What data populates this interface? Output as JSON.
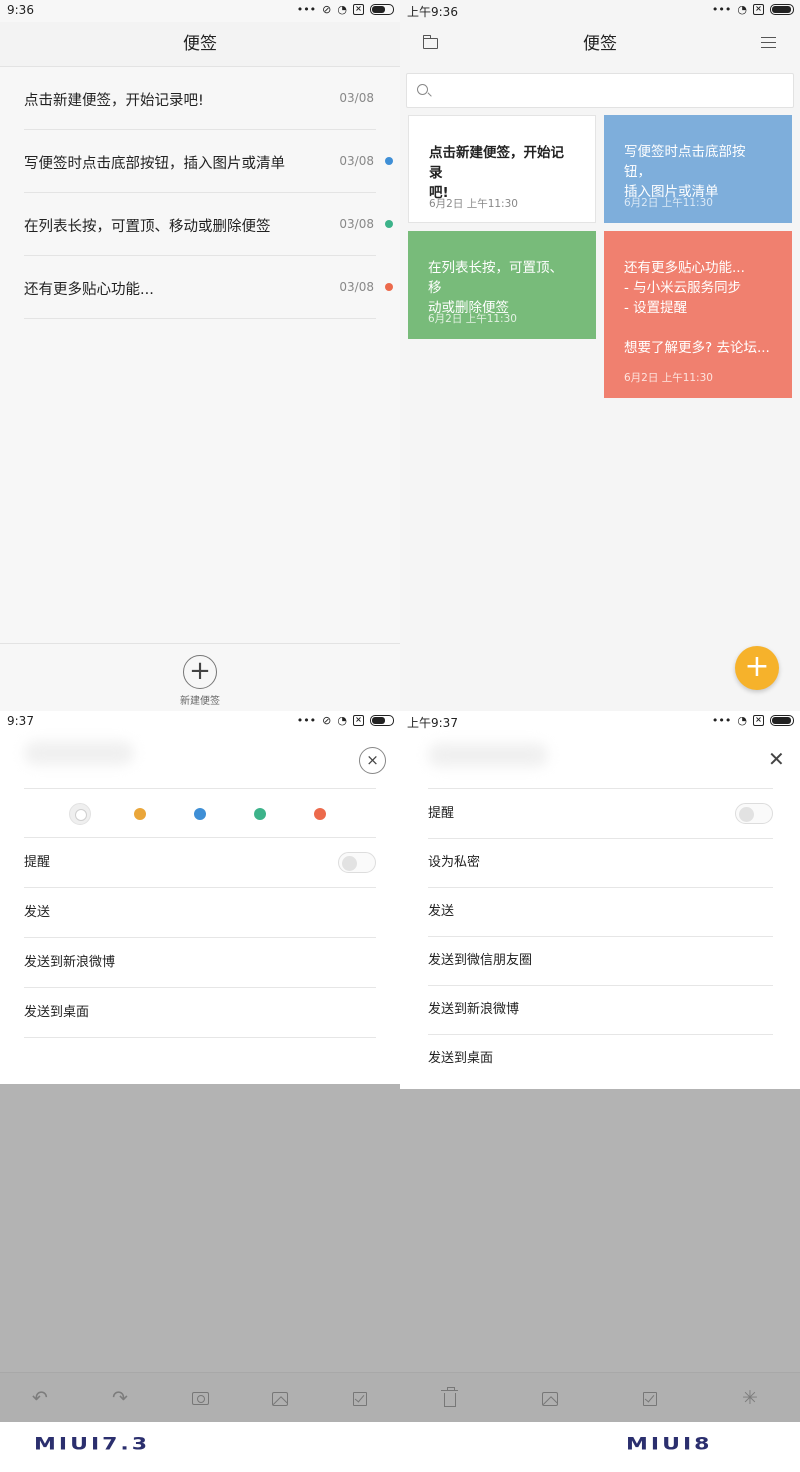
{
  "q1": {
    "status": {
      "time": "9:36"
    },
    "title": "便签",
    "notes": [
      {
        "text": "点击新建便签，开始记录吧!",
        "date": "03/08",
        "dot": ""
      },
      {
        "text": "写便签时点击底部按钮，插入图片或清单",
        "date": "03/08",
        "dot": "#3f8fd6"
      },
      {
        "text": "在列表长按，可置顶、移动或删除便签",
        "date": "03/08",
        "dot": "#3db38a"
      },
      {
        "text": "还有更多贴心功能...",
        "date": "03/08",
        "dot": "#ec6a4c"
      }
    ],
    "new_note_label": "新建便签"
  },
  "q2": {
    "status": {
      "time": "上午9:36"
    },
    "title": "便签",
    "cards": [
      {
        "text": "点击新建便签，开始记录\n吧!",
        "date": "6月2日 上午11:30",
        "bg": "#ffffff",
        "fg": "#222222"
      },
      {
        "text": "写便签时点击底部按钮，\n插入图片或清单",
        "date": "6月2日 上午11:30",
        "bg": "#7eaedb",
        "fg": "#ffffff"
      },
      {
        "text": "在列表长按，可置顶、移\n动或删除便签",
        "date": "6月2日 上午11:30",
        "bg": "#78bb7a",
        "fg": "#ffffff"
      },
      {
        "text": "还有更多贴心功能...\n  - 与小米云服务同步\n  - 设置提醒\n\n想要了解更多? 去论坛...",
        "date": "6月2日 上午11:30",
        "bg": "#f0806f",
        "fg": "#ffffff"
      }
    ],
    "fab_symbol": "+"
  },
  "q3": {
    "status": {
      "time": "9:37"
    },
    "colors": [
      "#ffffff",
      "#eaa63a",
      "#3f8fd6",
      "#3db38a",
      "#ec6a4c"
    ],
    "menu": {
      "reminder": "提醒",
      "send": "发送",
      "weibo": "发送到新浪微博",
      "desktop": "发送到桌面"
    }
  },
  "q4": {
    "status": {
      "time": "上午9:37"
    },
    "menu": {
      "reminder": "提醒",
      "private": "设为私密",
      "send": "发送",
      "moments": "发送到微信朋友圈",
      "weibo": "发送到新浪微博",
      "desktop": "发送到桌面"
    }
  },
  "labels": {
    "left": "MIUI7.3",
    "right": "MIUI8"
  }
}
